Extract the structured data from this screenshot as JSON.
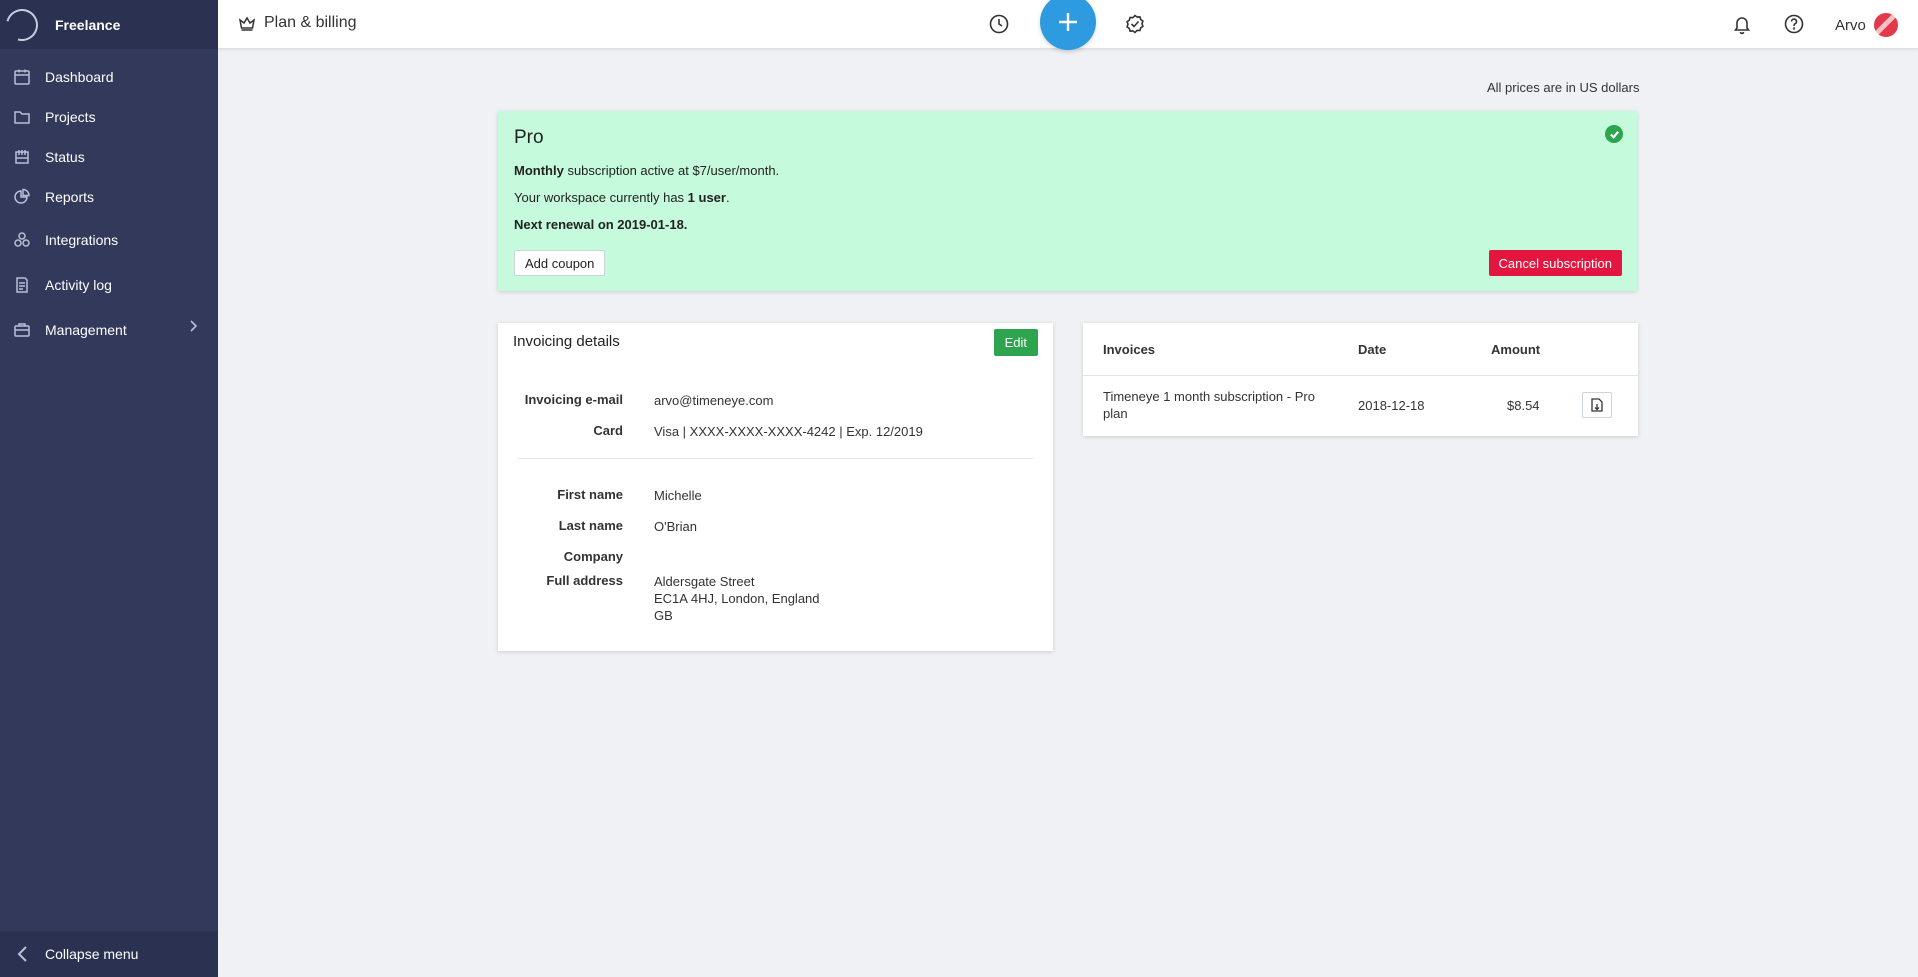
{
  "sidebar": {
    "workspace": "Freelance",
    "items": [
      {
        "label": "Dashboard",
        "icon": "calendar-icon"
      },
      {
        "label": "Projects",
        "icon": "folder-icon"
      },
      {
        "label": "Status",
        "icon": "status-icon"
      },
      {
        "label": "Reports",
        "icon": "pie-chart-icon"
      },
      {
        "label": "Integrations",
        "icon": "integrations-icon"
      },
      {
        "label": "Activity log",
        "icon": "log-icon"
      },
      {
        "label": "Management",
        "icon": "briefcase-icon"
      }
    ],
    "collapse_label": "Collapse menu"
  },
  "topbar": {
    "title": "Plan & billing",
    "user_name": "Arvo"
  },
  "price_note": "All prices are in US dollars",
  "plan": {
    "name": "Pro",
    "line1_bold": "Monthly",
    "line1_rest": " subscription active at $7/user/month.",
    "line2_prefix": "Your workspace currently has ",
    "line2_bold": "1 user",
    "line2_suffix": ".",
    "line3": "Next renewal on 2019-01-18.",
    "add_coupon": "Add coupon",
    "cancel": "Cancel subscription",
    "accent_color": "#c5fadc"
  },
  "invoicing": {
    "title": "Invoicing details",
    "edit": "Edit",
    "fields": [
      {
        "label": "Invoicing e-mail",
        "value": "arvo@timeneye.com"
      },
      {
        "label": "Card",
        "value": "Visa | XXXX-XXXX-XXXX-4242 | Exp. 12/2019"
      },
      {
        "label": "First name",
        "value": "Michelle"
      },
      {
        "label": "Last name",
        "value": "O'Brian"
      },
      {
        "label": "Company",
        "value": ""
      },
      {
        "label": "Full address",
        "value_lines": [
          "Aldersgate Street",
          "EC1A 4HJ, London, England",
          "GB"
        ]
      }
    ]
  },
  "invoices": {
    "headers": [
      "Invoices",
      "Date",
      "Amount"
    ],
    "rows": [
      {
        "name_line1": "Timeneye 1 month subscription - Pro",
        "name_line2": "plan",
        "date": "2018-12-18",
        "amount": "$8.54"
      }
    ]
  }
}
